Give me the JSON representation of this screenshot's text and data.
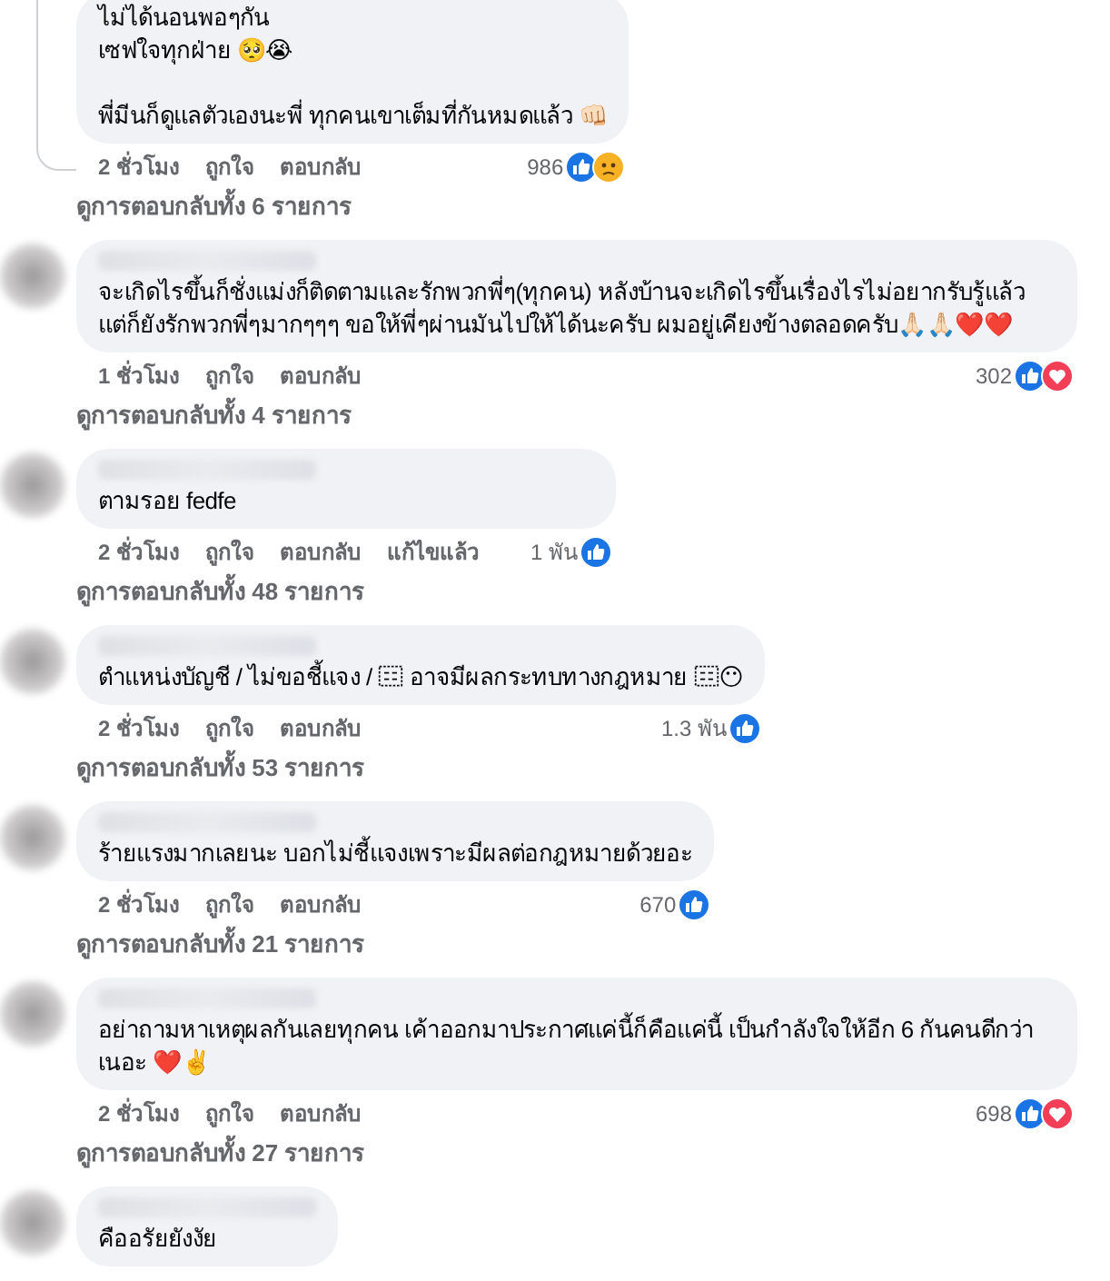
{
  "comments": [
    {
      "kind": "reply",
      "paragraphs": [
        [
          {
            "kind": "text",
            "text": "ไม่ได้นอนพอๆกัน"
          }
        ],
        [
          {
            "kind": "text",
            "text": "เซฟใจทุกฝ่าย 🥺😭"
          }
        ],
        [
          {
            "kind": "gap"
          }
        ],
        [
          {
            "kind": "text",
            "text": "พี่มีนก็ดูแลตัวเองนะพี่ ทุกคนเขาเต็มที่กันหมดแล้ว 👊🏻"
          }
        ]
      ],
      "time": "2 ชั่วโมง",
      "like": "ถูกใจ",
      "reply": "ตอบกลับ",
      "reaction_count": "986",
      "reactions": {
        "like": true,
        "love": false,
        "sad": true
      },
      "view_replies": "ดูการตอบกลับทั้ง 6 รายการ"
    },
    {
      "kind": "comment",
      "paragraphs": [
        [
          {
            "kind": "text",
            "text": "จะเกิดไรขึ้นก็ชั่งแม่งก็ติดตามและรักพวกพี่ๆ(ทุกคน) หลังบ้านจะเกิดไรขึ้นเรื่องไรไม่อยากรับรู้แล้ว แต่ก็ยังรักพวกพี่ๆมากๆๆๆ ขอให้พี่ๆผ่านมันไปให้ได้นะครับ ผมอยู่เคียงข้างตลอดครับ🙏🏻🙏🏻❤️❤️"
          }
        ]
      ],
      "time": "1 ชั่วโมง",
      "like": "ถูกใจ",
      "reply": "ตอบกลับ",
      "reaction_count": "302",
      "reactions": {
        "like": true,
        "love": true,
        "sad": false
      },
      "view_replies": "ดูการตอบกลับทั้ง 4 รายการ"
    },
    {
      "kind": "comment",
      "paragraphs": [
        [
          {
            "kind": "text",
            "text": "ตามรอย fedfe"
          }
        ]
      ],
      "time": "2 ชั่วโมง",
      "like": "ถูกใจ",
      "reply": "ตอบกลับ",
      "edited": "แก้ไขแล้ว",
      "reaction_count": "1 พัน",
      "reactions": {
        "like": true,
        "love": false,
        "sad": false
      },
      "view_replies": "ดูการตอบกลับทั้ง 48 รายการ"
    },
    {
      "kind": "comment",
      "paragraphs": [
        [
          {
            "kind": "text",
            "text": "ตำแหน่งบัญชี / ไม่ขอชี้แจง / "
          },
          {
            "kind": "unknown"
          },
          {
            "kind": "text",
            "text": " อาจมีผลกระทบทางกฎหมาย "
          },
          {
            "kind": "unknown"
          },
          {
            "kind": "text",
            "text": "😶"
          }
        ]
      ],
      "time": "2 ชั่วโมง",
      "like": "ถูกใจ",
      "reply": "ตอบกลับ",
      "reaction_count": "1.3 พัน",
      "reactions": {
        "like": true,
        "love": false,
        "sad": false
      },
      "view_replies": "ดูการตอบกลับทั้ง 53 รายการ"
    },
    {
      "kind": "comment",
      "paragraphs": [
        [
          {
            "kind": "text",
            "text": "ร้ายแรงมากเลยนะ บอกไม่ชี้แจงเพราะมีผลต่อกฎหมายด้วยอะ"
          }
        ]
      ],
      "time": "2 ชั่วโมง",
      "like": "ถูกใจ",
      "reply": "ตอบกลับ",
      "reaction_count": "670",
      "reactions": {
        "like": true,
        "love": false,
        "sad": false
      },
      "view_replies": "ดูการตอบกลับทั้ง 21 รายการ"
    },
    {
      "kind": "comment",
      "paragraphs": [
        [
          {
            "kind": "text",
            "text": "อย่าถามหาเหตุผลกันเลยทุกคน เค้าออกมาประกาศแค่นี้ก็คือแค่นี้ เป็นกำลังใจให้อีก 6 กันคนดีกว่าเนอะ ❤️✌️"
          }
        ]
      ],
      "time": "2 ชั่วโมง",
      "like": "ถูกใจ",
      "reply": "ตอบกลับ",
      "reaction_count": "698",
      "reactions": {
        "like": true,
        "love": true,
        "sad": false
      },
      "view_replies": "ดูการตอบกลับทั้ง 27 รายการ"
    },
    {
      "kind": "comment",
      "paragraphs": [
        [
          {
            "kind": "text",
            "text": "คืออรัยยังงัย"
          }
        ]
      ]
    }
  ]
}
